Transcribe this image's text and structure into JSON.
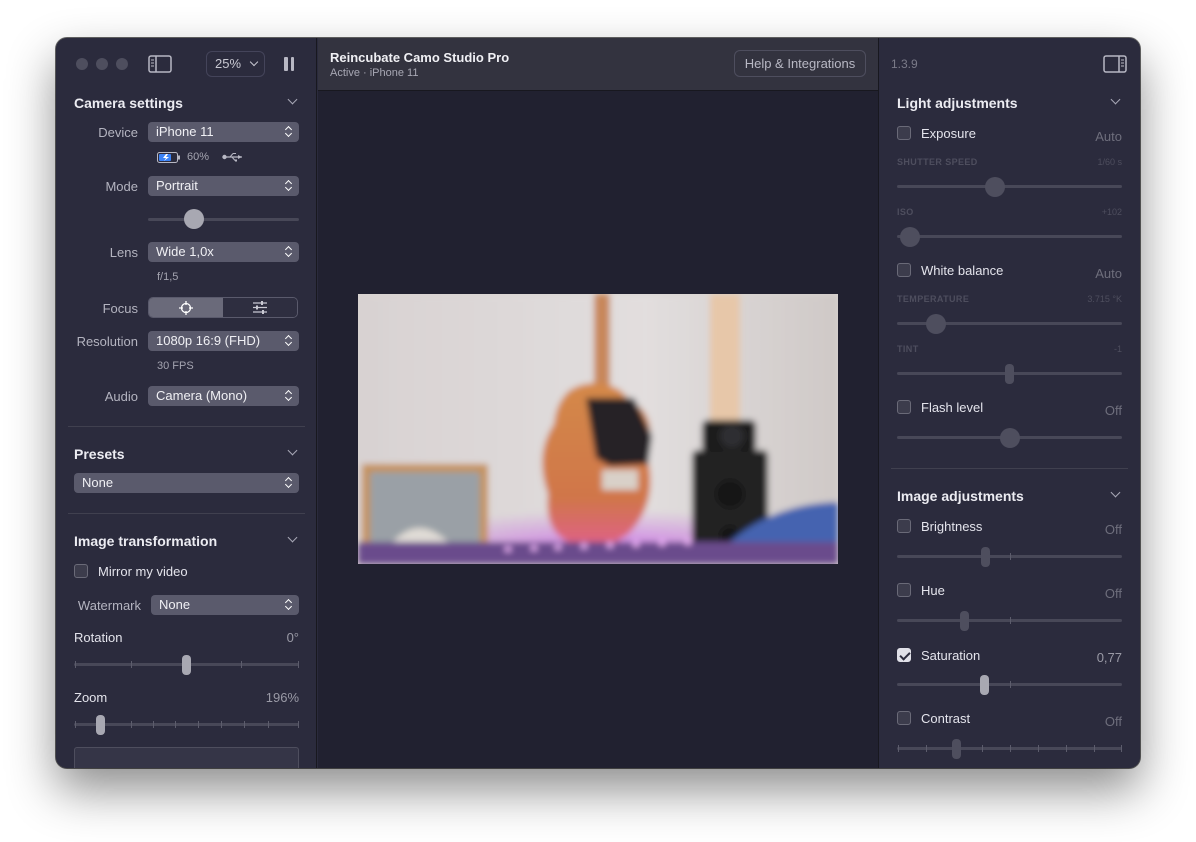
{
  "app": {
    "title": "Reincubate Camo Studio Pro",
    "status": "Active · iPhone 11",
    "help_label": "Help & Integrations",
    "version": "1.3.9",
    "zoom": "25%"
  },
  "camera": {
    "title": "Camera settings",
    "device_label": "Device",
    "device_value": "iPhone 11",
    "battery": "60%",
    "mode_label": "Mode",
    "mode_value": "Portrait",
    "lens_label": "Lens",
    "lens_value": "Wide 1,0x",
    "aperture": "f/1,5",
    "focus_label": "Focus",
    "resolution_label": "Resolution",
    "resolution_value": "1080p 16:9 (FHD)",
    "fps": "30 FPS",
    "audio_label": "Audio",
    "audio_value": "Camera (Mono)"
  },
  "presets": {
    "title": "Presets",
    "value": "None"
  },
  "transform": {
    "title": "Image transformation",
    "mirror_label": "Mirror my video",
    "mirror_checked": false,
    "watermark_label": "Watermark",
    "watermark_value": "None",
    "rotation_label": "Rotation",
    "rotation_value": "0°",
    "zoom_label": "Zoom",
    "zoom_value": "196%"
  },
  "light": {
    "title": "Light adjustments",
    "exposure_label": "Exposure",
    "exposure_value": "Auto",
    "shutter_label": "SHUTTER SPEED",
    "shutter_value": "1/60 s",
    "iso_label": "ISO",
    "iso_value": "+102",
    "wb_label": "White balance",
    "wb_value": "Auto",
    "temp_label": "TEMPERATURE",
    "temp_value": "3.715 °K",
    "tint_label": "TINT",
    "tint_value": "-1",
    "flash_label": "Flash level",
    "flash_value": "Off"
  },
  "image": {
    "title": "Image adjustments",
    "brightness_label": "Brightness",
    "brightness_value": "Off",
    "hue_label": "Hue",
    "hue_value": "Off",
    "saturation_label": "Saturation",
    "saturation_value": "0,77",
    "saturation_checked": true,
    "contrast_label": "Contrast",
    "contrast_value": "Off"
  },
  "colors": {
    "panel": "#2b2b3d",
    "canvas": "#212130",
    "accent": "#5a5a6c"
  }
}
